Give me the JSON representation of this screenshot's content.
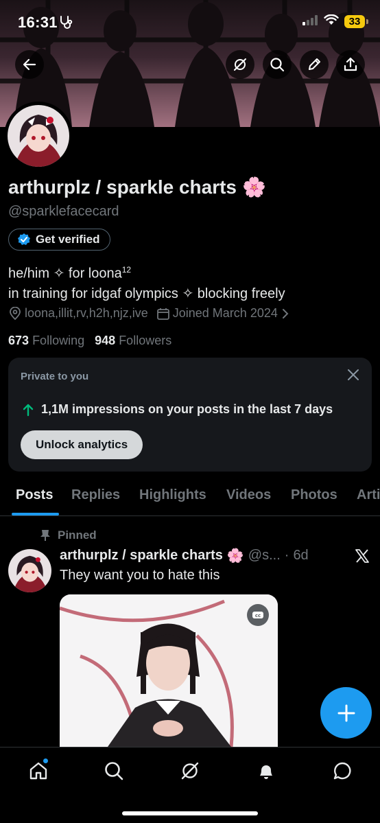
{
  "status_bar": {
    "time": "16:31",
    "battery": "33"
  },
  "profile": {
    "name": "arthurplz / sparkle charts",
    "name_emoji": "🌸",
    "handle": "@sparklefacecard",
    "verify_label": "Get verified",
    "bio_line1": "he/him ✧ for loona",
    "bio_sup": "12",
    "bio_line2": "in training for idgaf olympics ✧ blocking freely",
    "location": "loona,illit,rv,h2h,njz,ive",
    "joined": "Joined March 2024",
    "following_count": "673",
    "following_label": "Following",
    "followers_count": "948",
    "followers_label": "Followers"
  },
  "private_card": {
    "title": "Private to you",
    "impressions": "1,1M impressions on your posts in the last 7 days",
    "button": "Unlock analytics"
  },
  "tabs": [
    "Posts",
    "Replies",
    "Highlights",
    "Videos",
    "Photos",
    "Articles"
  ],
  "post": {
    "pinned_label": "Pinned",
    "author": "arthurplz / sparkle charts",
    "author_emoji": "🌸",
    "handle_short": "@s...",
    "dot": "·",
    "time": "6d",
    "text": "They want you to hate this"
  },
  "colors": {
    "accent": "#1d9bf0",
    "background": "#000000",
    "muted": "#71767b",
    "card": "#16181c"
  },
  "icons": [
    "back-arrow-icon",
    "grok-icon",
    "search-icon",
    "edit-icon",
    "share-icon",
    "verified-badge-icon",
    "location-icon",
    "calendar-icon",
    "chevron-right-icon",
    "close-icon",
    "arrow-up-icon",
    "pin-icon",
    "x-logo-icon",
    "cc-icon",
    "plus-icon",
    "home-icon",
    "search-icon",
    "grok-icon",
    "bell-icon",
    "messages-icon"
  ]
}
